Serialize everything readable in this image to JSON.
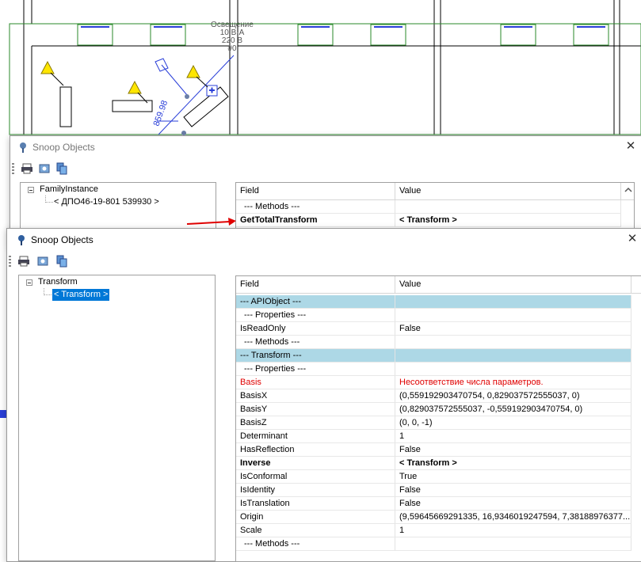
{
  "cad": {
    "label_lines": [
      "Освещение",
      "10 В·А",
      "220 В",
      "#0"
    ],
    "dimension": "859.98",
    "colors": {
      "wall": "#000000",
      "green": "#2a8a2a",
      "blue": "#2a3fd8",
      "warning": "#ffe600"
    }
  },
  "back_window": {
    "title": "Snoop Objects",
    "close": "✕",
    "toolbar": [
      "print-icon",
      "snapshot-icon",
      "copy-icon"
    ],
    "tree": {
      "root": "FamilyInstance",
      "child": "< ДПО46-19-801  539930 >"
    },
    "grid": {
      "headers": {
        "field": "Field",
        "value": "Value"
      },
      "rows": [
        {
          "field": "--- Methods ---",
          "value": "",
          "type": "sub"
        },
        {
          "field": "GetTotalTransform",
          "value": "< Transform >",
          "type": "bold"
        }
      ]
    }
  },
  "front_window": {
    "title": "Snoop Objects",
    "close": "✕",
    "toolbar": [
      "print-icon",
      "snapshot-icon",
      "copy-icon"
    ],
    "tree": {
      "root": "Transform",
      "child": "< Transform >"
    },
    "grid": {
      "headers": {
        "field": "Field",
        "value": "Value"
      },
      "rows": [
        {
          "field": "--- APIObject ---",
          "value": "",
          "type": "group"
        },
        {
          "field": "--- Properties ---",
          "value": "",
          "type": "sub"
        },
        {
          "field": "IsReadOnly",
          "value": "False",
          "type": "normal"
        },
        {
          "field": "--- Methods ---",
          "value": "",
          "type": "sub"
        },
        {
          "field": "--- Transform ---",
          "value": "",
          "type": "group"
        },
        {
          "field": "--- Properties ---",
          "value": "",
          "type": "sub"
        },
        {
          "field": "Basis",
          "value": "Несоответствие числа параметров.",
          "type": "error"
        },
        {
          "field": "BasisX",
          "value": "(0,559192903470754, 0,829037572555037, 0)",
          "type": "normal"
        },
        {
          "field": "BasisY",
          "value": "(0,829037572555037, -0,559192903470754, 0)",
          "type": "normal"
        },
        {
          "field": "BasisZ",
          "value": "(0, 0, -1)",
          "type": "normal"
        },
        {
          "field": "Determinant",
          "value": "1",
          "type": "normal"
        },
        {
          "field": "HasReflection",
          "value": "False",
          "type": "normal"
        },
        {
          "field": "Inverse",
          "value": "< Transform >",
          "type": "bold"
        },
        {
          "field": "IsConformal",
          "value": "True",
          "type": "normal"
        },
        {
          "field": "IsIdentity",
          "value": "False",
          "type": "normal"
        },
        {
          "field": "IsTranslation",
          "value": "False",
          "type": "normal"
        },
        {
          "field": "Origin",
          "value": "(9,59645669291335, 16,9346019247594, 7,38188976377...",
          "type": "normal"
        },
        {
          "field": "Scale",
          "value": "1",
          "type": "normal"
        },
        {
          "field": "--- Methods ---",
          "value": "",
          "type": "sub"
        }
      ]
    }
  }
}
